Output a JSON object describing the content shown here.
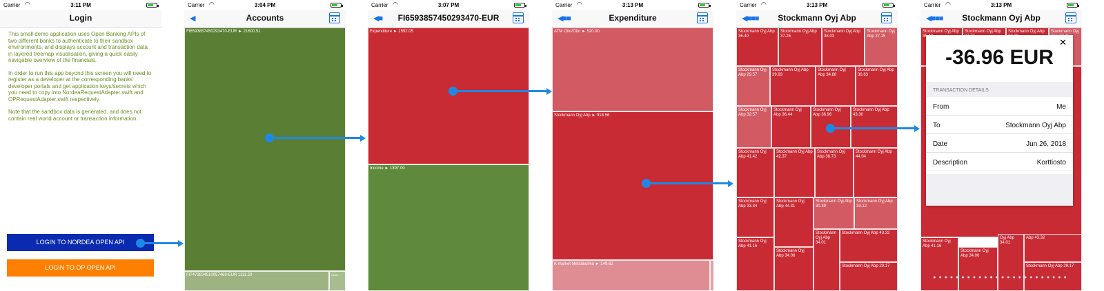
{
  "status": {
    "carrier": "Carrier",
    "times": [
      "3:11 PM",
      "3:04 PM",
      "3:07 PM",
      "3:13 PM",
      "3:13 PM",
      "3:13 PM"
    ]
  },
  "screen1": {
    "title": "Login",
    "intro": [
      "This small demo application uses Open Banking APIs of two different banks to authenticate to their sandbox environments, and displays account and transaction data in layered treemap visualisation, giving a quick easily navigable overview of the financials.",
      "In order to run this app beyond this screen you will need to register as a developer at the corresponding banks' developer portals and get application keys/secrets which you need to copy into NordeaRequestAdapter.swift and OPRequestAdapter.swift respectively.",
      "Note that the sandbox data is generated, and does not contain real world account or transaction information."
    ],
    "nordea_button": "LOGIN TO NORDEA OPEN API",
    "op_button": "LOGIN TO OP OPEN API"
  },
  "screen2": {
    "title": "Accounts",
    "tiles": [
      "FI6593857450293470-EUR ► 21600.51",
      "FI7473834510057469-EUR 1111.50",
      "FI3384..."
    ]
  },
  "screen3": {
    "title": "FI6593857450293470-EUR",
    "tiles": [
      "Expenditure ► 1592.05",
      "Income ► 1397.00"
    ]
  },
  "screen4": {
    "title": "Expenditure",
    "tiles": [
      "ATM Otto/Otto ► 520.00",
      "Stockmann Oyj Abp ► 918.56",
      "K market Metsäkulma ► 149.62"
    ]
  },
  "screen5": {
    "title": "Stockmann Oyj Abp",
    "tiles": [
      "Stockmann Oyj Abp 36.40",
      "Stockmann Oyj Abp 37.26",
      "Stockmann Oyj Abp 38.03",
      "Stockmann Oyj Abp 27.15",
      "Stockmann Oyj Abp 29.57",
      "Stockmann Oyj Abp 39.93",
      "Stockmann Oyj Abp 34.88",
      "Stockmann Oyj Abp 36.63",
      "Stockmann Oyj Abp 32.57",
      "Stockmann Oyj Abp 36.44",
      "Stockmann Oyj Abp 36.96",
      "Stockmann Oyj Abp 43.30",
      "Stockmann Oyj Abp 41.42",
      "Stockmann Oyj Abp 42.37",
      "Stockmann Oyj Abp 38.73",
      "Stockmann Oyj Abp 44.04",
      "Stockmann Oyj Abp 33.34",
      "Stockmann Oyj Abp 44.31",
      "Stockmann Oyj Abp 30.39",
      "Stockmann Oyj Abp 33.12",
      "Stockmann Oyj Abp 41.16",
      "Stockmann Oyj Abp 34.06",
      "Stockmann Oyj Abp 34.01",
      "Stockmann Oyj Abp 43.32",
      "Stockmann Oyj Abp 29.17"
    ]
  },
  "screen6": {
    "title": "Stockmann Oyj Abp",
    "bg_tiles": [
      "Stockmann Oyj Abp 36.40",
      "Stockmann Oyj Abp 37.26",
      "Stockmann Oyj Abp 38.03",
      "Stockmann Oyj Abp 27.15",
      "Stockmann Oyj Abp 41.16",
      "Stockmann Oyj Abp 34.06",
      "Oyj Abp 34.01",
      "Abp 43.32",
      "Stockmann Oyj Abp 29.17"
    ],
    "amount": "-36.96 EUR",
    "section": "TRANSACTION DETAILS",
    "rows": [
      {
        "k": "From",
        "v": "Me"
      },
      {
        "k": "To",
        "v": "Stockmann Oyj Abp"
      },
      {
        "k": "Date",
        "v": "Jun 26, 2018"
      },
      {
        "k": "Description",
        "v": "Korttiosto"
      }
    ],
    "close": "✕"
  },
  "colors": {
    "green": "#5a7f34",
    "red": "#c92b35",
    "blue_btn": "#0a2ab0",
    "orange_btn": "#ff8000",
    "arrow": "#1e88e5"
  }
}
